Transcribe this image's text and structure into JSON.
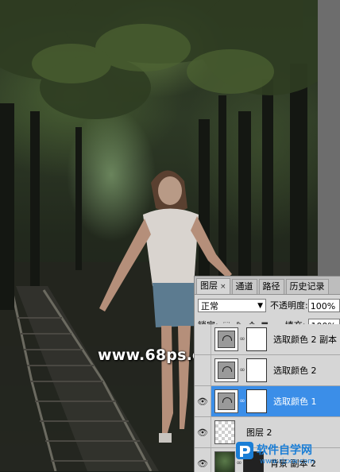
{
  "panel": {
    "tabs": [
      {
        "label": "图层",
        "close": "×"
      },
      {
        "label": "通道"
      },
      {
        "label": "路径"
      },
      {
        "label": "历史记录"
      }
    ],
    "blend_mode": "正常",
    "opacity_label": "不透明度:",
    "opacity_value": "100%",
    "lock_label": "锁定:",
    "fill_label": "填充:",
    "fill_value": "100%",
    "layers": [
      {
        "name": "选取颜色 2 副本",
        "visible": false,
        "type": "adjustment"
      },
      {
        "name": "选取颜色 2",
        "visible": false,
        "type": "adjustment"
      },
      {
        "name": "选取颜色 1",
        "visible": true,
        "type": "adjustment",
        "selected": true
      },
      {
        "name": "图层 2",
        "visible": true,
        "type": "pixel"
      },
      {
        "name": "背景 副本 2",
        "visible": true,
        "type": "photo"
      }
    ]
  },
  "watermarks": {
    "site": "www.68ps.com",
    "logo_text": "软件自学网",
    "logo_url": "www.rjzxw.com"
  },
  "colors": {
    "selection": "#3b8ee8",
    "panel_bg": "#d6d6d6",
    "logo_blue": "#1a7ed6"
  }
}
